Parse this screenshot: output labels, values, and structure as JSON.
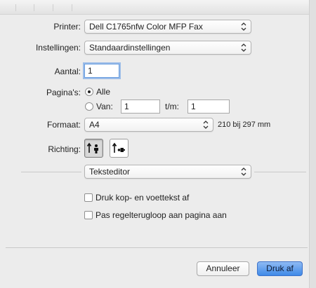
{
  "printer": {
    "label": "Printer:",
    "value": "Dell C1765nfw Color MFP Fax"
  },
  "presets": {
    "label": "Instellingen:",
    "value": "Standaardinstellingen"
  },
  "copies": {
    "label": "Aantal:",
    "value": "1"
  },
  "pages": {
    "label": "Pagina's:",
    "all_label": "Alle",
    "from_label": "Van:",
    "from_value": "1",
    "to_label": "t/m:",
    "to_value": "1"
  },
  "paper_size": {
    "label": "Formaat:",
    "value": "A4",
    "dimensions": "210 bij 297 mm"
  },
  "orientation": {
    "label": "Richting:"
  },
  "section_menu": {
    "value": "Teksteditor"
  },
  "options": {
    "header_footer_label": "Druk kop- en voettekst af",
    "rewrap_label": "Pas regelterugloop aan pagina aan"
  },
  "buttons": {
    "cancel_label": "Annuleer",
    "print_label": "Druk af"
  },
  "colors": {
    "accent": "#3f8ae8",
    "background": "#ececec"
  },
  "state": {
    "pages_mode": "all",
    "orientation": "portrait",
    "print_headers_footers": false,
    "rewrap_contents": false
  }
}
